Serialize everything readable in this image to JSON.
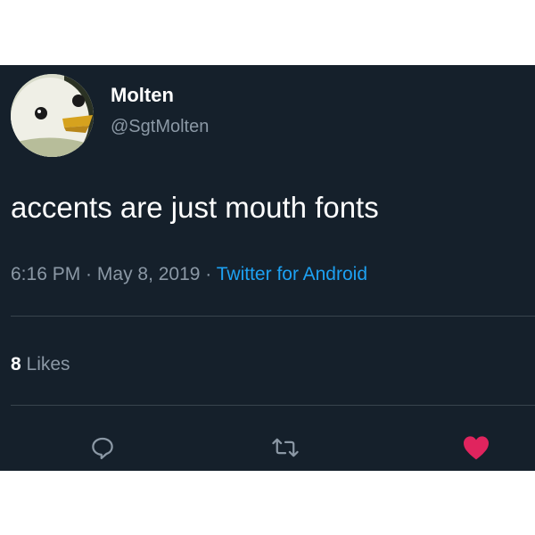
{
  "tweet": {
    "author": {
      "display_name": "Molten",
      "handle": "@SgtMolten"
    },
    "text": "accents are just mouth fonts",
    "meta": {
      "time": "6:16 PM",
      "separator": " · ",
      "date": "May 8, 2019",
      "source": "Twitter for Android"
    },
    "stats": {
      "likes_count": "8",
      "likes_label": " Likes"
    },
    "actions": {
      "reply_icon": "reply-icon",
      "retweet_icon": "retweet-icon",
      "like_icon": "heart-icon",
      "liked": true
    }
  },
  "colors": {
    "background": "#15202b",
    "text": "#ffffff",
    "muted": "#8b98a5",
    "link": "#1da1f2",
    "like": "#e0245e"
  }
}
